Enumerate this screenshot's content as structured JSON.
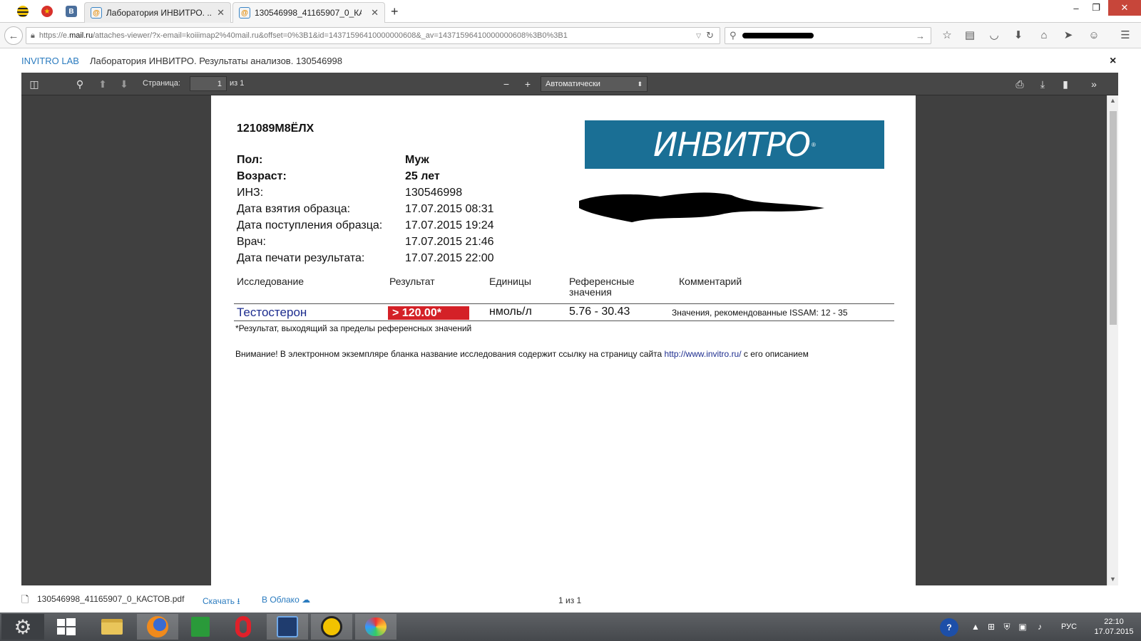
{
  "browser": {
    "tabs": [
      {
        "label": "Лаборатория ИНВИТРО. ..."
      },
      {
        "label": "130546998_41165907_0_КА..."
      }
    ],
    "pinned_tabs": [
      {
        "icon": "beeline-icon"
      },
      {
        "icon": "emblem-icon"
      },
      {
        "icon": "vk-icon",
        "glyph": "В"
      }
    ],
    "new_tab_glyph": "+",
    "url_prefix": "https://e.",
    "url_host": "mail.ru",
    "url_rest": "/attaches-viewer/?x-email=koiiimap2%40mail.ru&offset=0%3B1&id=14371596410000000608&_av=14371596410000000608%3B0%3B1"
  },
  "attachment": {
    "brand": "INVITRO LAB",
    "title": "Лаборатория ИНВИТРО. Результаты анализов. 130546998",
    "close_glyph": "×"
  },
  "pdf_toolbar": {
    "page_label": "Страница:",
    "page_value": "1",
    "page_of": "из 1",
    "zoom": "Автоматически"
  },
  "report": {
    "order_id": "121089М8ЁЛХ",
    "logo_text": "ИНВИТРО",
    "logo_mark": "®",
    "fields": [
      {
        "label": "Пол:",
        "value": "Муж"
      },
      {
        "label": "Возраст:",
        "value": "25 лет"
      },
      {
        "label": "ИНЗ:",
        "value": "130546998"
      },
      {
        "label": "Дата взятия образца:",
        "value": "17.07.2015 08:31"
      },
      {
        "label": "Дата поступления образца:",
        "value": "17.07.2015 19:24"
      },
      {
        "label": "Врач:",
        "value": "17.07.2015 21:46"
      },
      {
        "label": "Дата печати результата:",
        "value": "17.07.2015 22:00"
      }
    ],
    "columns": [
      "Исследование",
      "Результат",
      "Единицы",
      "Референсные значения",
      "Комментарий"
    ],
    "row": {
      "test": "Тестостерон",
      "result": "> 120.00*",
      "units": "нмоль/л",
      "reference": "5.76 - 30.43",
      "comment": "Значения, рекомендованные ISSAM: 12 - 35"
    },
    "footnote": "*Результат, выходящий за пределы референсных значений",
    "notice_before": "Внимание! В электронном экземпляре бланка название исследования содержит ссылку на страницу сайта ",
    "notice_link": "http://www.invitro.ru/",
    "notice_after": " с его описанием"
  },
  "footer": {
    "file_name": "130546998_41165907_0_КАСТОВ.pdf",
    "download": "Скачать",
    "cloud": "В Облако",
    "page_count": "1 из 1"
  },
  "taskbar": {
    "lang": "РУС",
    "time": "22:10",
    "date": "17.07.2015"
  },
  "colors": {
    "logo_bg": "#1a6f95",
    "result_bg": "#d42127",
    "link": "#2a7bbf",
    "pdf_toolbar": "#474747",
    "pdf_bg": "#404040"
  }
}
